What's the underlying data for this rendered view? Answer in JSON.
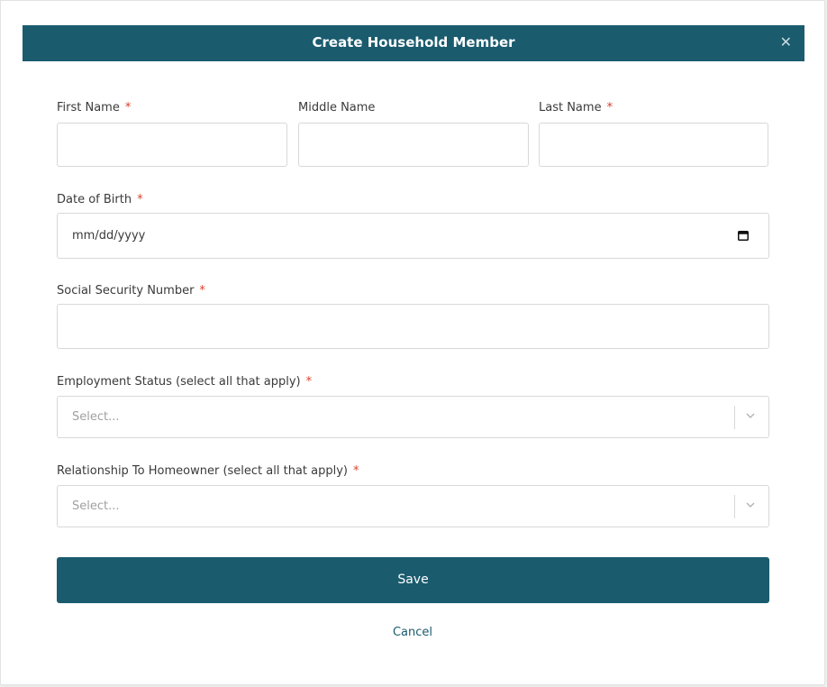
{
  "dialog": {
    "title": "Create Household Member",
    "close_icon": "close-icon"
  },
  "form": {
    "first_name": {
      "label": "First Name",
      "required": "*",
      "value": ""
    },
    "middle_name": {
      "label": "Middle Name",
      "value": ""
    },
    "last_name": {
      "label": "Last Name",
      "required": "*",
      "value": ""
    },
    "date_of_birth": {
      "label": "Date of Birth",
      "required": "*",
      "placeholder": "mm/dd/yyyy",
      "icon": "calendar-icon"
    },
    "ssn": {
      "label": "Social Security Number",
      "required": "*",
      "value": ""
    },
    "employment_status": {
      "label": "Employment Status (select all that apply)",
      "required": "*",
      "placeholder": "Select...",
      "icon": "chevron-down-icon"
    },
    "relationship": {
      "label": "Relationship To Homeowner (select all that apply)",
      "required": "*",
      "placeholder": "Select...",
      "icon": "chevron-down-icon"
    }
  },
  "actions": {
    "save_label": "Save",
    "cancel_label": "Cancel"
  },
  "colors": {
    "primary": "#1a5b6e",
    "required": "#d9422b",
    "border": "#d8d8d8"
  }
}
